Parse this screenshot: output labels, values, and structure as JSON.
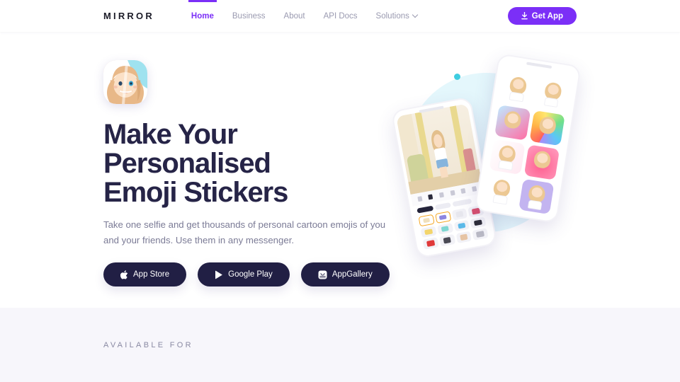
{
  "header": {
    "logo": "MIRROR",
    "nav": [
      {
        "label": "Home",
        "active": true,
        "has_dropdown": false
      },
      {
        "label": "Business",
        "active": false,
        "has_dropdown": false
      },
      {
        "label": "About",
        "active": false,
        "has_dropdown": false
      },
      {
        "label": "API Docs",
        "active": false,
        "has_dropdown": false
      },
      {
        "label": "Solutions",
        "active": false,
        "has_dropdown": true
      }
    ],
    "cta": {
      "label": "Get App",
      "icon": "download-arrow-icon",
      "color": "#7b2ff7"
    }
  },
  "hero": {
    "app_icon_name": "mirror-app-icon",
    "headline_line1": "Make Your",
    "headline_line2": "Personalised",
    "headline_line3": "Emoji Stickers",
    "subcopy": "Take one selfie and get thousands of personal cartoon emojis of you and your friends. Use them in any messenger.",
    "store_buttons": [
      {
        "label": "App Store",
        "icon": "apple-icon"
      },
      {
        "label": "Google Play",
        "icon": "google-play-icon"
      },
      {
        "label": "AppGallery",
        "icon": "appgallery-icon"
      }
    ],
    "illustration": {
      "name": "phone-mockups-illustration",
      "blob_color": "#e4f7fc",
      "dots": [
        {
          "name": "decor-dot-cyan",
          "color": "#3ecde0"
        },
        {
          "name": "decor-dot-purple",
          "color": "#7b2ff7"
        },
        {
          "name": "decor-dot-orange-right",
          "color": "#fbc07c"
        },
        {
          "name": "decor-dot-orange-bottom",
          "color": "#fbc07c"
        }
      ]
    }
  },
  "available_section": {
    "label": "AVAILABLE FOR",
    "background": "#f7f6fb"
  },
  "theme": {
    "accent": "#7b2ff7",
    "heading": "#262447",
    "body_text": "#7b7b96",
    "dark_button": "#211f44"
  }
}
